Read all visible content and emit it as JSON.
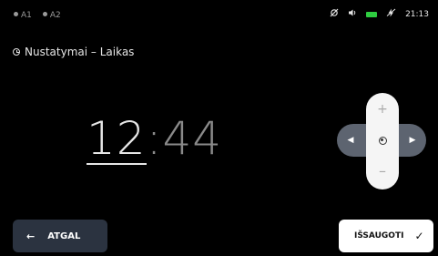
{
  "status": {
    "indicator_a": "A1",
    "indicator_b": "A2",
    "icons": [
      "signal-slash-icon",
      "speaker-icon",
      "battery-icon",
      "no-charge-icon"
    ],
    "battery_color": "#2ecc40",
    "time": "21:13"
  },
  "page": {
    "title": "Nustatymai – Laikas"
  },
  "clock": {
    "hours": "12",
    "separator": ":",
    "minutes": "44"
  },
  "dpad": {
    "up": "+",
    "down": "–",
    "left": "◀",
    "right": "▶"
  },
  "footer": {
    "back_label": "ATGAL",
    "back_arrow": "←",
    "save_label": "IŠSAUGOTI",
    "save_check": "✓"
  }
}
